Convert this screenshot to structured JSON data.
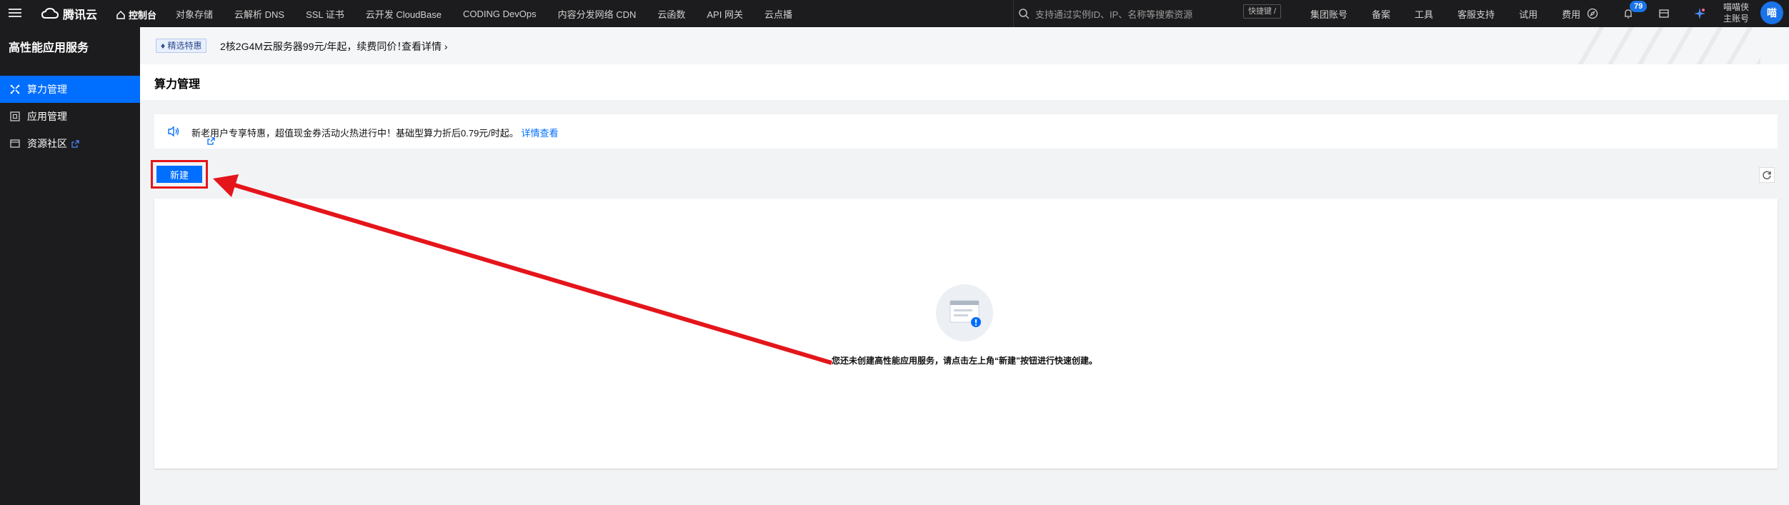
{
  "topbar": {
    "logo_text": "腾讯云",
    "console_label": "控制台",
    "nav_items": [
      "对象存储",
      "云解析 DNS",
      "SSL 证书",
      "云开发 CloudBase",
      "CODING DevOps",
      "内容分发网络 CDN",
      "云函数",
      "API 网关",
      "云点播"
    ],
    "search_placeholder": "支持通过实例ID、IP、名称等搜索资源",
    "shortcut_label": "快捷键 /",
    "right_items": [
      "集团账号",
      "备案",
      "工具",
      "客服支持",
      "试用",
      "费用"
    ],
    "notification_count": "79",
    "user_name": "喵喵侠",
    "user_role": "主账号",
    "avatar_text": "喵"
  },
  "sidebar": {
    "title": "高性能应用服务",
    "items": [
      {
        "label": "算力管理",
        "active": true
      },
      {
        "label": "应用管理",
        "active": false
      },
      {
        "label": "资源社区",
        "active": false
      }
    ]
  },
  "promo": {
    "tag": "♦ 精选特惠",
    "text": "2核2G4M云服务器99元/年起，续费同价！",
    "link": "查看详情"
  },
  "page": {
    "title": "算力管理"
  },
  "notice": {
    "text": "新老用户专享特惠，超值现金券活动火热进行中！基础型算力折后0.79元/时起。",
    "link": "详情查看"
  },
  "actions": {
    "new_label": "新建"
  },
  "empty": {
    "text": "您还未创建高性能应用服务，请点击左上角“新建”按钮进行快速创建。"
  },
  "colors": {
    "primary": "#006eff",
    "annotation_red": "#e4151b",
    "topbar_bg": "#1c1c1e"
  }
}
